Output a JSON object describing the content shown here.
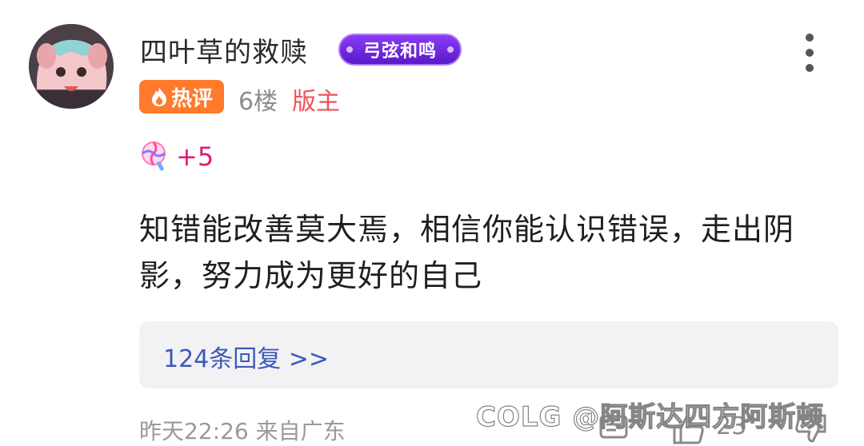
{
  "post": {
    "username": "四叶草的救赎",
    "group_badge": "弓弦和鸣",
    "hot_label": "热评",
    "floor": "6楼",
    "role": "版主",
    "candy_text": "+5",
    "content": "知错能改善莫大焉，相信你能认识错误，走出阴影，努力成为更好的自己",
    "reply_link": "124条回复 >>",
    "timestamp": "昨天22:26 来自广东",
    "like_count": "23"
  },
  "watermark": {
    "text": "@阿斯达四方阿斯顿",
    "logo": "COLG"
  },
  "colors": {
    "badge_purple": "#6a23e0",
    "hot_orange": "#ff7a2a",
    "role_red": "#f0505a",
    "candy_pink": "#e0197a",
    "link_blue": "#3d59b7"
  }
}
